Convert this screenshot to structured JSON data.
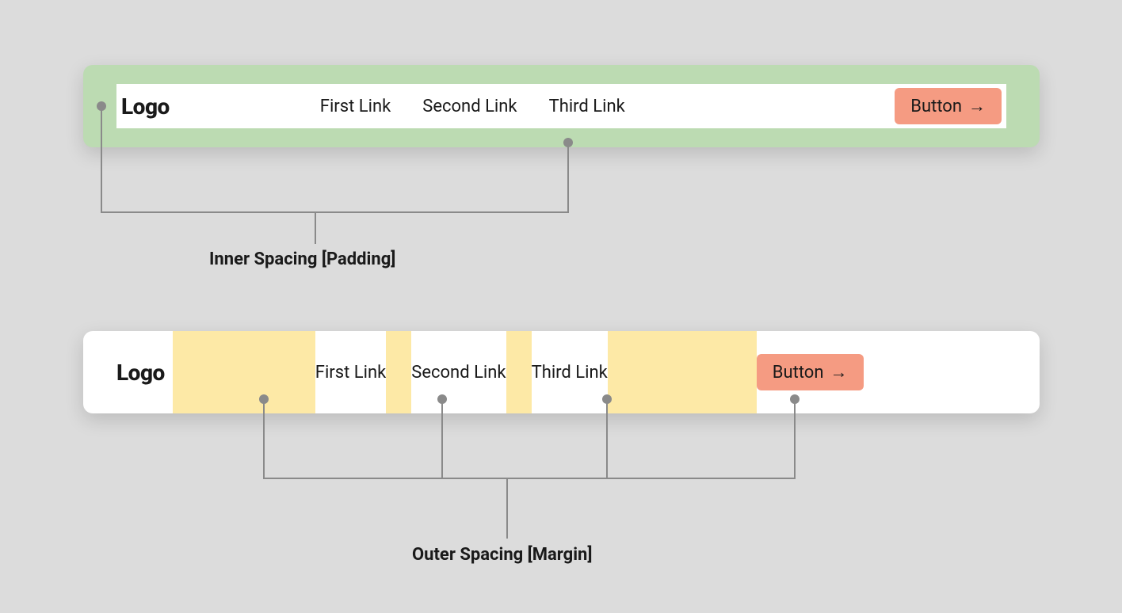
{
  "logo_text": "Logo",
  "links": [
    "First Link",
    "Second Link",
    "Third Link"
  ],
  "button_label": "Button",
  "captions": {
    "padding": "Inner Spacing [Padding]",
    "margin": "Outer Spacing [Margin]"
  },
  "colors": {
    "padding_bg": "#bcdbb2",
    "margin_bg": "#fde9a6",
    "button_bg": "#f59b82",
    "page_bg": "#dcdcdc"
  }
}
